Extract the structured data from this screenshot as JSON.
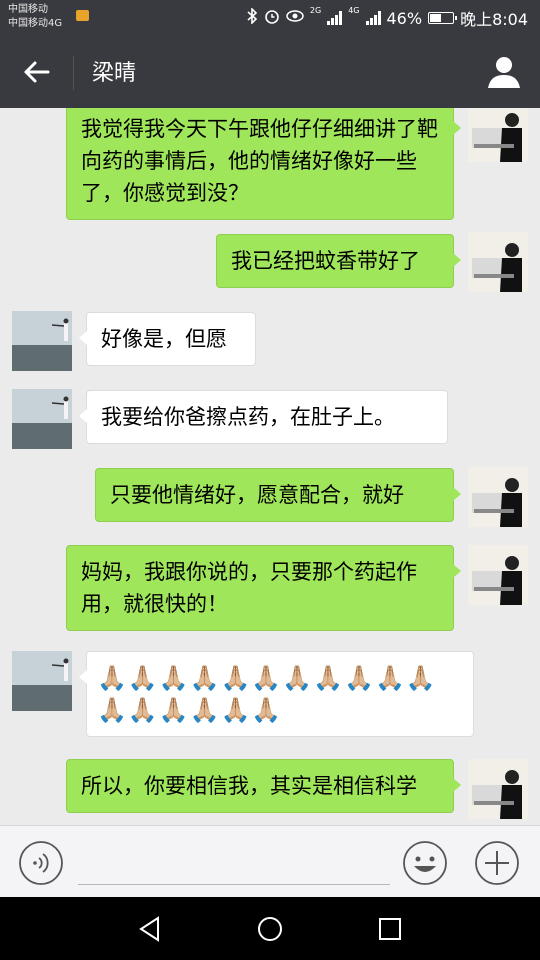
{
  "status_bar": {
    "carrier_line1": "中国移动",
    "carrier_line2": "中国移动4G",
    "network_label_1": "2G",
    "network_label_2": "4G",
    "battery_percent": "46%",
    "battery_level": 0.46,
    "time": "晚上8:04",
    "icons": [
      "bluetooth-icon",
      "alarm-icon",
      "eye-icon",
      "signal-icon",
      "battery-icon"
    ]
  },
  "header": {
    "title": "梁晴",
    "back_icon": "arrow-left-icon",
    "profile_icon": "person-icon"
  },
  "messages": [
    {
      "sender": "me",
      "text": "我觉得我今天下午跟他仔仔细细讲了靶向药的事情后，他的情绪好像好一些了，你感觉到没？"
    },
    {
      "sender": "me",
      "text": "我已经把蚊香带好了"
    },
    {
      "sender": "other",
      "text": "好像是，但愿"
    },
    {
      "sender": "other",
      "text": "我要给你爸擦点药，在肚子上。"
    },
    {
      "sender": "me",
      "text": "只要他情绪好，愿意配合，就好"
    },
    {
      "sender": "me",
      "text": "妈妈，我跟你说的，只要那个药起作用，就很快的！"
    },
    {
      "sender": "other",
      "text": "🙏🏼🙏🏼🙏🏼🙏🏼🙏🏼🙏🏼🙏🏼🙏🏼🙏🏼🙏🏼🙏🏼🙏🏼🙏🏼🙏🏼🙏🏼🙏🏼🙏🏼"
    },
    {
      "sender": "me",
      "text": "所以，你要相信我，其实是相信科学"
    }
  ],
  "input_bar": {
    "voice_icon": "voice-icon",
    "emoji_icon": "emoji-icon",
    "more_icon": "plus-icon",
    "text_value": ""
  },
  "nav_bar": {
    "icons": [
      "nav-back-icon",
      "nav-home-icon",
      "nav-recent-icon"
    ]
  },
  "colors": {
    "header_bg": "#393a3f",
    "chat_bg": "#ebebeb",
    "my_bubble": "#9fe65a",
    "their_bubble": "#ffffff"
  }
}
